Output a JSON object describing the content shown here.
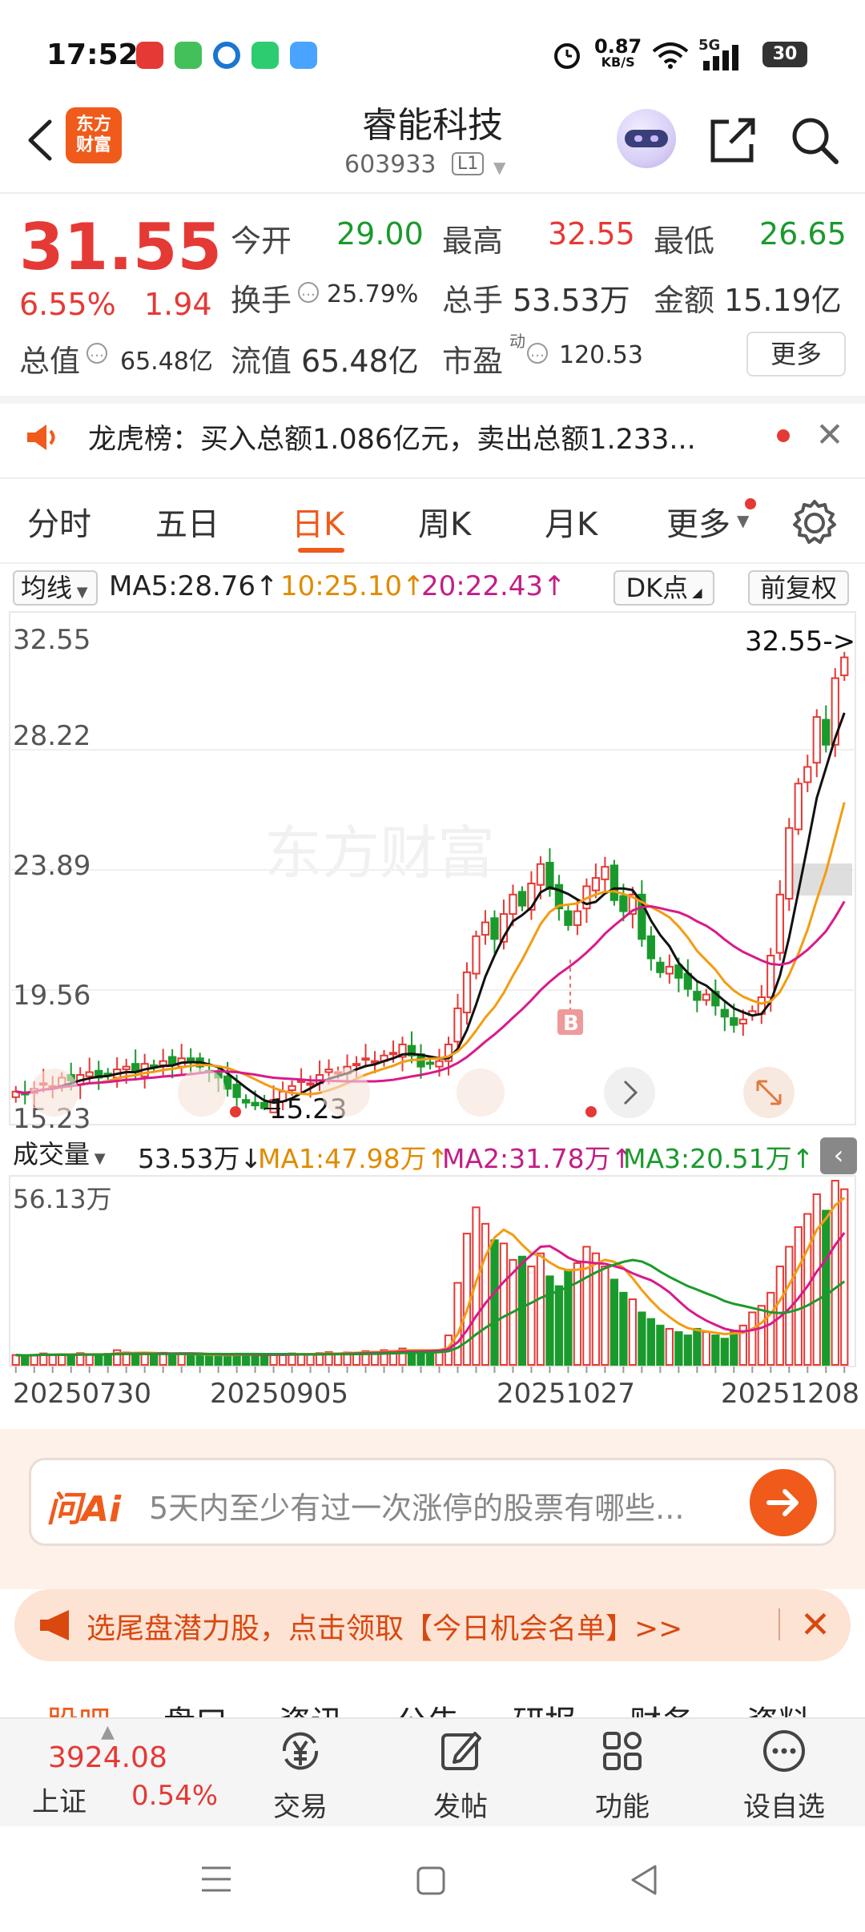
{
  "status_bar": {
    "time": "17:52",
    "net_speed_value": "0.87",
    "net_speed_unit": "KB/S",
    "network": "5G",
    "battery": "30"
  },
  "header": {
    "logo_text": "东方财富",
    "stock_name": "睿能科技",
    "stock_code": "603933",
    "level_badge": "L1"
  },
  "quote": {
    "price": "31.55",
    "change_pct": "6.55%",
    "change": "1.94",
    "open_label": "今开",
    "open": "29.00",
    "high_label": "最高",
    "high": "32.55",
    "low_label": "最低",
    "low": "26.65",
    "turnover_label": "换手",
    "turnover": "25.79%",
    "volume_label": "总手",
    "volume": "53.53万",
    "amount_label": "金额",
    "amount": "15.19亿",
    "mktcap_label": "总值",
    "mktcap": "65.48亿",
    "float_label": "流值",
    "float_cap": "65.48亿",
    "pe_label": "市盈",
    "pe_sup": "动",
    "pe": "120.53",
    "more_label": "更多"
  },
  "ticker": {
    "text": "龙虎榜：买入总额1.086亿元，卖出总额1.233..."
  },
  "tabs": {
    "items": [
      "分时",
      "五日",
      "日K",
      "周K",
      "月K",
      "更多"
    ],
    "active": "日K"
  },
  "ma_row": {
    "select_label": "均线",
    "ma5": "MA5:28.76↑",
    "ma10": "10:25.10↑",
    "ma20": "20:22.43↑",
    "dk_label": "DK点",
    "fq_label": "前复权"
  },
  "colors": {
    "up": "#e53935",
    "down": "#1a9a2c",
    "ma5": "#111111",
    "ma10": "#f39c12",
    "ma20": "#d81b8a",
    "accent": "#f05a1a"
  },
  "kline": {
    "y_labels": [
      "32.55",
      "28.22",
      "23.89",
      "19.56",
      "15.23"
    ],
    "high_marker": "32.55->",
    "low_marker": "15.23",
    "buy_marker": "B",
    "watermark": "东方财富"
  },
  "volume": {
    "select_label": "成交量",
    "vol": "53.53万↓",
    "ma1": "MA1:47.98万↑",
    "ma2": "MA2:31.78万↑",
    "ma3": "MA3:20.51万↑",
    "max_label": "56.13万"
  },
  "dates": [
    "20250730",
    "20250905",
    "20251027",
    "20251208"
  ],
  "chart_data": {
    "type": "candlestick",
    "y_range": [
      15.23,
      32.55
    ],
    "volume_max": "56.13万",
    "x_ticks": [
      "20250730",
      "20250905",
      "20251027",
      "20251208"
    ],
    "closes": [
      15.9,
      15.8,
      16.0,
      16.2,
      16.1,
      16.4,
      16.3,
      16.5,
      16.6,
      16.4,
      16.5,
      16.7,
      16.8,
      16.6,
      16.9,
      16.8,
      17.0,
      16.9,
      17.1,
      17.0,
      16.8,
      16.6,
      16.4,
      16.0,
      15.7,
      15.5,
      15.4,
      15.3,
      15.6,
      15.9,
      16.1,
      16.3,
      16.2,
      16.5,
      16.7,
      16.6,
      16.8,
      16.9,
      17.1,
      17.0,
      17.2,
      17.3,
      17.6,
      17.2,
      16.8,
      16.9,
      17.0,
      17.6,
      18.9,
      20.2,
      21.5,
      22.0,
      21.4,
      22.3,
      23.0,
      22.6,
      23.4,
      24.1,
      23.2,
      22.5,
      21.9,
      22.4,
      23.3,
      23.6,
      24.0,
      22.8,
      22.4,
      23.0,
      21.4,
      20.7,
      20.2,
      20.4,
      20.0,
      19.6,
      19.2,
      19.4,
      19.0,
      18.6,
      18.3,
      18.5,
      18.8,
      19.3,
      20.8,
      23.0,
      25.4,
      27.0,
      27.6,
      29.4,
      28.4,
      30.8,
      31.55
    ],
    "volumes": [
      3,
      2.8,
      3.1,
      3.5,
      3.0,
      3.3,
      2.9,
      3.6,
      3.2,
      3.0,
      3.4,
      4.5,
      3.8,
      3.6,
      3.3,
      3.0,
      3.7,
      3.2,
      3.5,
      3.1,
      2.8,
      2.9,
      3.0,
      3.2,
      3.4,
      3.1,
      2.9,
      3.0,
      3.3,
      3.2,
      3.5,
      3.3,
      3.1,
      3.6,
      3.9,
      3.4,
      3.8,
      3.7,
      4.2,
      4.0,
      4.5,
      4.3,
      5.0,
      4.4,
      4.1,
      4.3,
      4.6,
      9.0,
      25.0,
      40.0,
      48.0,
      43.0,
      38.0,
      37.0,
      32.0,
      33.0,
      30.0,
      34.0,
      27.0,
      24.0,
      29.0,
      31.0,
      36.0,
      34.0,
      30.0,
      26.0,
      22.0,
      20.0,
      16.0,
      14.0,
      12.0,
      11.0,
      10.0,
      9.0,
      11.0,
      10.0,
      9.0,
      8.0,
      10.0,
      12.0,
      16.0,
      18.0,
      22.0,
      30.0,
      36.0,
      42.0,
      46.0,
      52.0,
      47.0,
      56.13,
      53.53
    ]
  },
  "ai": {
    "logo": "问Ai",
    "placeholder": "5天内至少有过一次涨停的股票有哪些..."
  },
  "promo": {
    "text": "选尾盘潜力股，点击领取【今日机会名单】>>"
  },
  "subtabs": [
    "股吧",
    "盘口",
    "资讯",
    "公告",
    "研报",
    "财务",
    "资料"
  ],
  "bottom_nav": {
    "index_value": "3924.08",
    "index_name": "上证",
    "index_pct": "0.54%",
    "items": [
      "交易",
      "发帖",
      "功能",
      "设自选"
    ]
  }
}
